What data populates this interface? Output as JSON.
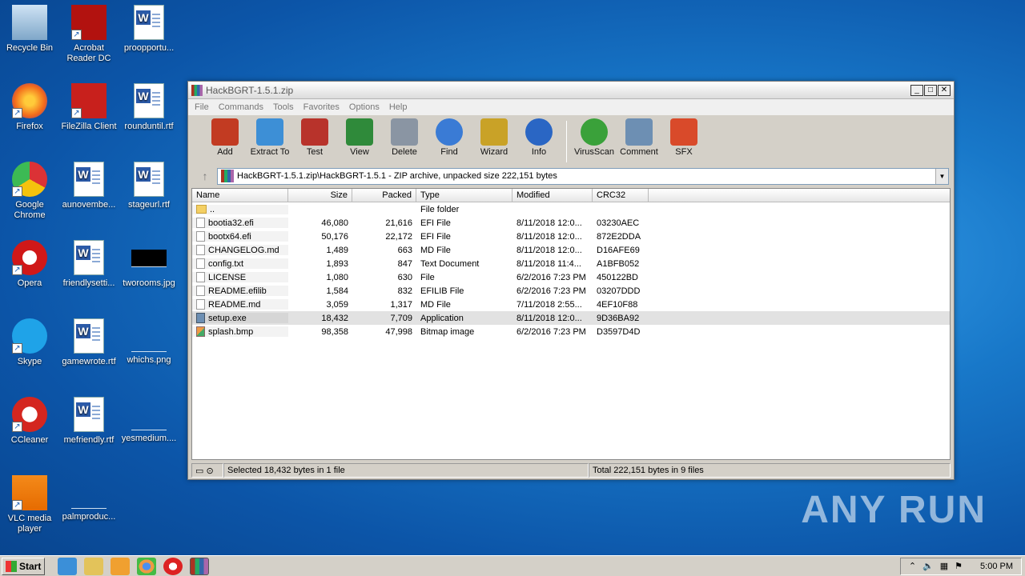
{
  "desktop": {
    "icons": [
      {
        "label": "Recycle Bin",
        "icon": "recycle-bin-icon"
      },
      {
        "label": "Acrobat Reader DC",
        "icon": "acrobat-icon"
      },
      {
        "label": "proopportu...",
        "icon": "word-doc-icon"
      },
      {
        "label": "Firefox",
        "icon": "firefox-icon"
      },
      {
        "label": "FileZilla Client",
        "icon": "filezilla-icon"
      },
      {
        "label": "rounduntil.rtf",
        "icon": "word-doc-icon"
      },
      {
        "label": "Google Chrome",
        "icon": "chrome-icon"
      },
      {
        "label": "aunovembe...",
        "icon": "word-doc-icon"
      },
      {
        "label": "stageurl.rtf",
        "icon": "word-doc-icon"
      },
      {
        "label": "Opera",
        "icon": "opera-icon"
      },
      {
        "label": "friendlysetti...",
        "icon": "word-doc-icon"
      },
      {
        "label": "tworooms.jpg",
        "icon": "image-icon"
      },
      {
        "label": "Skype",
        "icon": "skype-icon"
      },
      {
        "label": "gamewrote.rtf",
        "icon": "word-doc-icon"
      },
      {
        "label": "whichs.png",
        "icon": "image-icon"
      },
      {
        "label": "CCleaner",
        "icon": "ccleaner-icon"
      },
      {
        "label": "mefriendly.rtf",
        "icon": "word-doc-icon"
      },
      {
        "label": "yesmedium....",
        "icon": "image-icon"
      },
      {
        "label": "VLC media player",
        "icon": "vlc-icon"
      },
      {
        "label": "palmproduc...",
        "icon": "image-icon"
      }
    ],
    "watermark": "ANY RUN"
  },
  "window": {
    "title": "HackBGRT-1.5.1.zip",
    "menu": [
      "File",
      "Commands",
      "Tools",
      "Favorites",
      "Options",
      "Help"
    ],
    "toolbar": [
      {
        "label": "Add",
        "icon": "add-archive-icon",
        "color": "#c23b22"
      },
      {
        "label": "Extract To",
        "icon": "extract-folder-icon",
        "color": "#3d8fd6"
      },
      {
        "label": "Test",
        "icon": "test-clipboard-icon",
        "color": "#b8332b"
      },
      {
        "label": "View",
        "icon": "view-book-icon",
        "color": "#2f8a3a"
      },
      {
        "label": "Delete",
        "icon": "trash-icon",
        "color": "#8a95a3"
      },
      {
        "label": "Find",
        "icon": "magnifier-icon",
        "color": "#3a7bd5"
      },
      {
        "label": "Wizard",
        "icon": "wand-icon",
        "color": "#c9a227"
      },
      {
        "label": "Info",
        "icon": "info-icon",
        "color": "#2a66c4"
      },
      {
        "label": "VirusScan",
        "icon": "bug-scan-icon",
        "color": "#3aa13a"
      },
      {
        "label": "Comment",
        "icon": "comment-icon",
        "color": "#6d8fb3"
      },
      {
        "label": "SFX",
        "icon": "sfx-archive-icon",
        "color": "#d94a2a"
      }
    ],
    "address": "HackBGRT-1.5.1.zip\\HackBGRT-1.5.1 - ZIP archive, unpacked size 222,151 bytes",
    "columns": {
      "name": "Name",
      "size": "Size",
      "packed": "Packed",
      "type": "Type",
      "modified": "Modified",
      "crc": "CRC32"
    },
    "files": [
      {
        "name": "..",
        "size": "",
        "packed": "",
        "type": "File folder",
        "modified": "",
        "crc": "",
        "kind": "folder"
      },
      {
        "name": "bootia32.efi",
        "size": "46,080",
        "packed": "21,616",
        "type": "EFI File",
        "modified": "8/11/2018 12:0...",
        "crc": "03230AEC",
        "kind": "file"
      },
      {
        "name": "bootx64.efi",
        "size": "50,176",
        "packed": "22,172",
        "type": "EFI File",
        "modified": "8/11/2018 12:0...",
        "crc": "872E2DDA",
        "kind": "file"
      },
      {
        "name": "CHANGELOG.md",
        "size": "1,489",
        "packed": "663",
        "type": "MD File",
        "modified": "8/11/2018 12:0...",
        "crc": "D16AFE69",
        "kind": "file"
      },
      {
        "name": "config.txt",
        "size": "1,893",
        "packed": "847",
        "type": "Text Document",
        "modified": "8/11/2018 11:4...",
        "crc": "A1BFB052",
        "kind": "file"
      },
      {
        "name": "LICENSE",
        "size": "1,080",
        "packed": "630",
        "type": "File",
        "modified": "6/2/2016 7:23 PM",
        "crc": "450122BD",
        "kind": "file"
      },
      {
        "name": "README.efilib",
        "size": "1,584",
        "packed": "832",
        "type": "EFILIB File",
        "modified": "6/2/2016 7:23 PM",
        "crc": "03207DDD",
        "kind": "file"
      },
      {
        "name": "README.md",
        "size": "3,059",
        "packed": "1,317",
        "type": "MD File",
        "modified": "7/11/2018 2:55...",
        "crc": "4EF10F88",
        "kind": "file"
      },
      {
        "name": "setup.exe",
        "size": "18,432",
        "packed": "7,709",
        "type": "Application",
        "modified": "8/11/2018 12:0...",
        "crc": "9D36BA92",
        "kind": "exe",
        "selected": true
      },
      {
        "name": "splash.bmp",
        "size": "98,358",
        "packed": "47,998",
        "type": "Bitmap image",
        "modified": "6/2/2016 7:23 PM",
        "crc": "D3597D4D",
        "kind": "bmp"
      }
    ],
    "status_left": "Selected 18,432 bytes in 1 file",
    "status_right": "Total 222,151 bytes in 9 files"
  },
  "taskbar": {
    "start_label": "Start",
    "clock": "5:00 PM"
  }
}
